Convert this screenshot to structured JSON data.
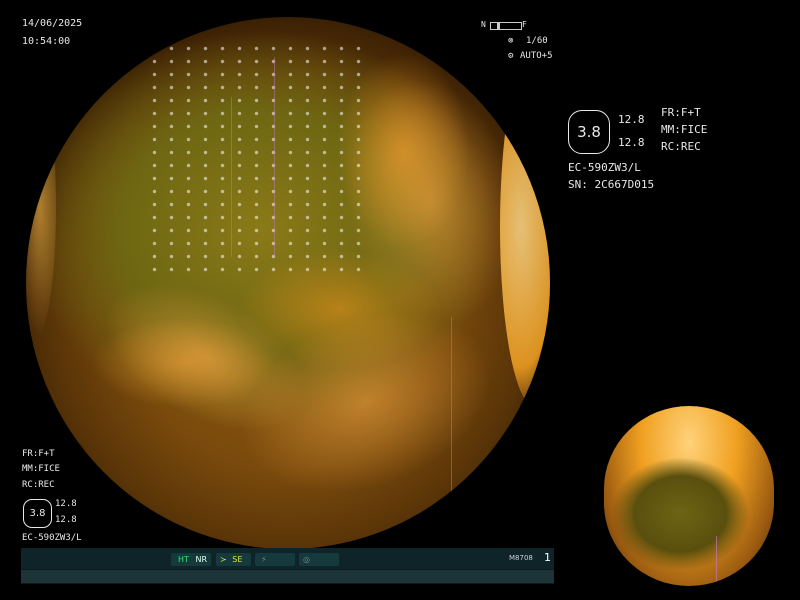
{
  "date": "14/06/2025",
  "time": "10:54:00",
  "focus_near": "N",
  "focus_far": "F",
  "shutter": "1/60",
  "auto_level": "AUTO+5",
  "right_panel": {
    "zoom": "3.8",
    "val1": "12.8",
    "val2": "12.8",
    "fr": "FR:F+T",
    "mm": "MM:FICE",
    "rc": "RC:REC",
    "scope": "EC-590ZW3/L",
    "serial": "SN: 2C667D015"
  },
  "left_panel": {
    "fr": "FR:F+T",
    "mm": "MM:FICE",
    "rc": "RC:REC",
    "zoom": "3.8",
    "val1": "12.8",
    "val2": "12.8",
    "scope": "EC-590ZW3/L"
  },
  "status_bar": {
    "ht": "HT",
    "nr": "NR",
    "se": "SE",
    "model": "M8708",
    "page": "1"
  },
  "colors": {
    "background": "#000000",
    "ht_green": "#3ce06a",
    "se_yellow": "#d8e040",
    "text": "#e8e8e8"
  }
}
